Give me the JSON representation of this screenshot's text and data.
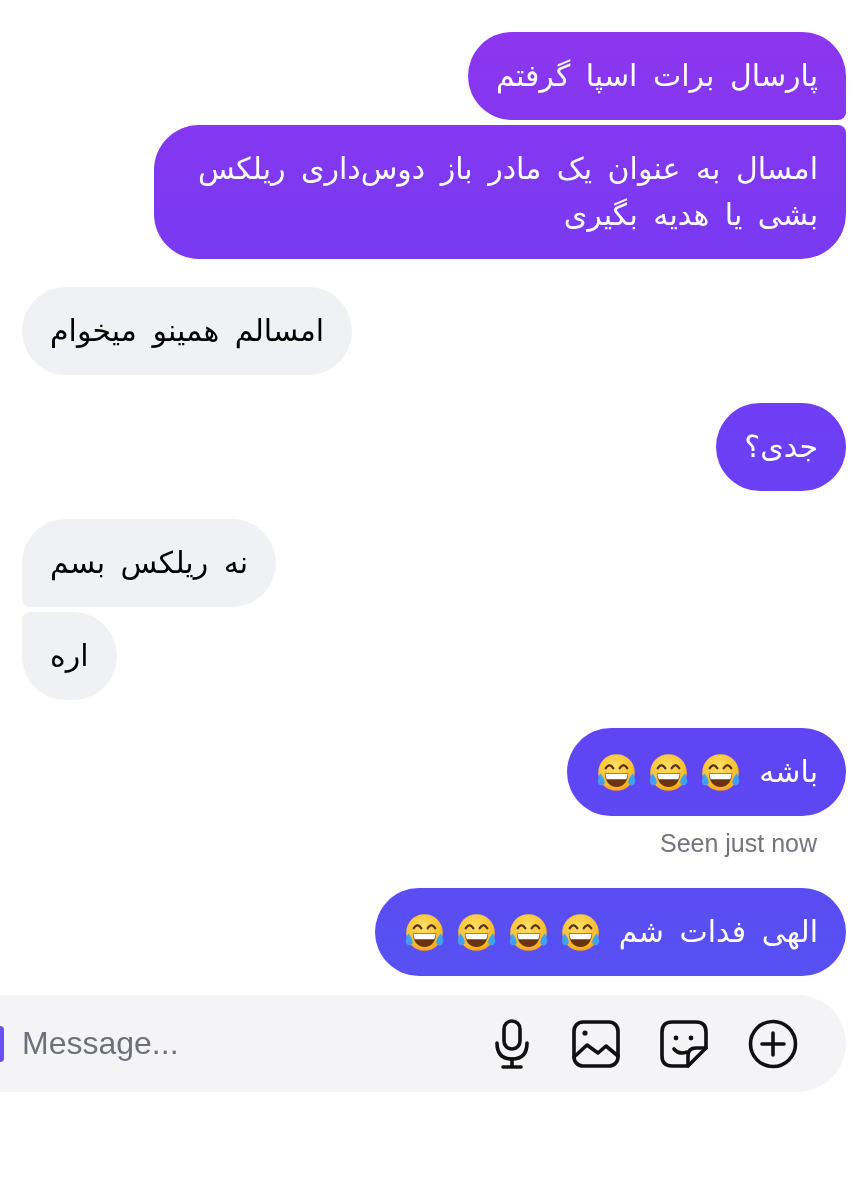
{
  "messages": [
    {
      "kind": "sent",
      "text": "پارسال برات اسپا گرفتم"
    },
    {
      "kind": "sent",
      "text": "امسال به عنوان یک مادر باز دوس‌داری ریلکس بشی یا هدیه بگیری"
    },
    {
      "kind": "received",
      "text": "امسالم همینو میخوام"
    },
    {
      "kind": "sent",
      "text": "جدی؟"
    },
    {
      "kind": "received",
      "text": "نه ریلکس بسم"
    },
    {
      "kind": "received",
      "text": "اره"
    },
    {
      "kind": "sent",
      "text": "باشه",
      "emojis": [
        {
          "kind": "laughing"
        },
        {
          "kind": "laughing"
        },
        {
          "kind": "laughing"
        }
      ],
      "receipt": "Seen just now"
    },
    {
      "kind": "sent",
      "text": "الهی فدات شم",
      "emojis": [
        {
          "kind": "laughing"
        },
        {
          "kind": "laughing"
        },
        {
          "kind": "laughing"
        },
        {
          "kind": "laughing"
        }
      ]
    }
  ],
  "composer": {
    "placeholder": "Message..."
  }
}
